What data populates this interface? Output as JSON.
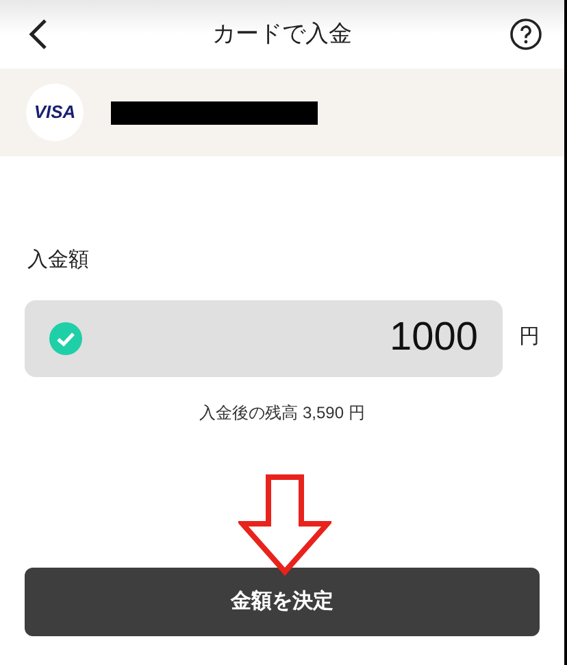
{
  "header": {
    "title": "カードで入金"
  },
  "card": {
    "brand": "VISA",
    "number_redacted": true
  },
  "amount": {
    "label": "入金額",
    "value": "1000",
    "valid": true,
    "unit": "円"
  },
  "balance_after": "入金後の残高 3,590 円",
  "submit_button": "金額を決定",
  "annotation": {
    "kind": "down-arrow"
  }
}
